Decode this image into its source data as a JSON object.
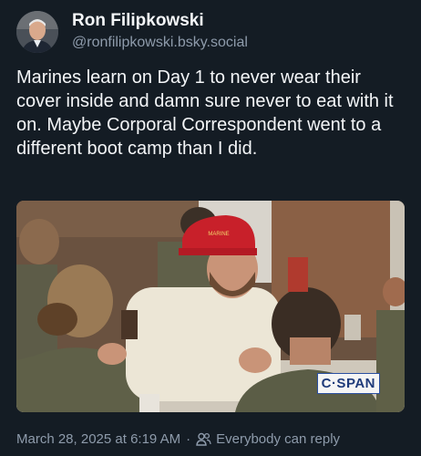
{
  "author": {
    "name": "Ron Filipkowski",
    "handle": "@ronfilipkowski.bsky.social"
  },
  "post": {
    "text": "Marines learn on Day 1 to never wear their cover inside and damn sure never to eat with it on. Maybe Corporal Correspondent went to a different boot camp than I did."
  },
  "media": {
    "badge": "C·SPAN",
    "hat_text": "MARINE"
  },
  "footer": {
    "timestamp": "March 28, 2025 at 6:19 AM",
    "separator": "·",
    "reply_setting": "Everybody can reply",
    "reply_icon": "people-icon"
  },
  "colors": {
    "background": "#141c24",
    "text": "#f4f6f8",
    "muted": "#8e9bab"
  }
}
